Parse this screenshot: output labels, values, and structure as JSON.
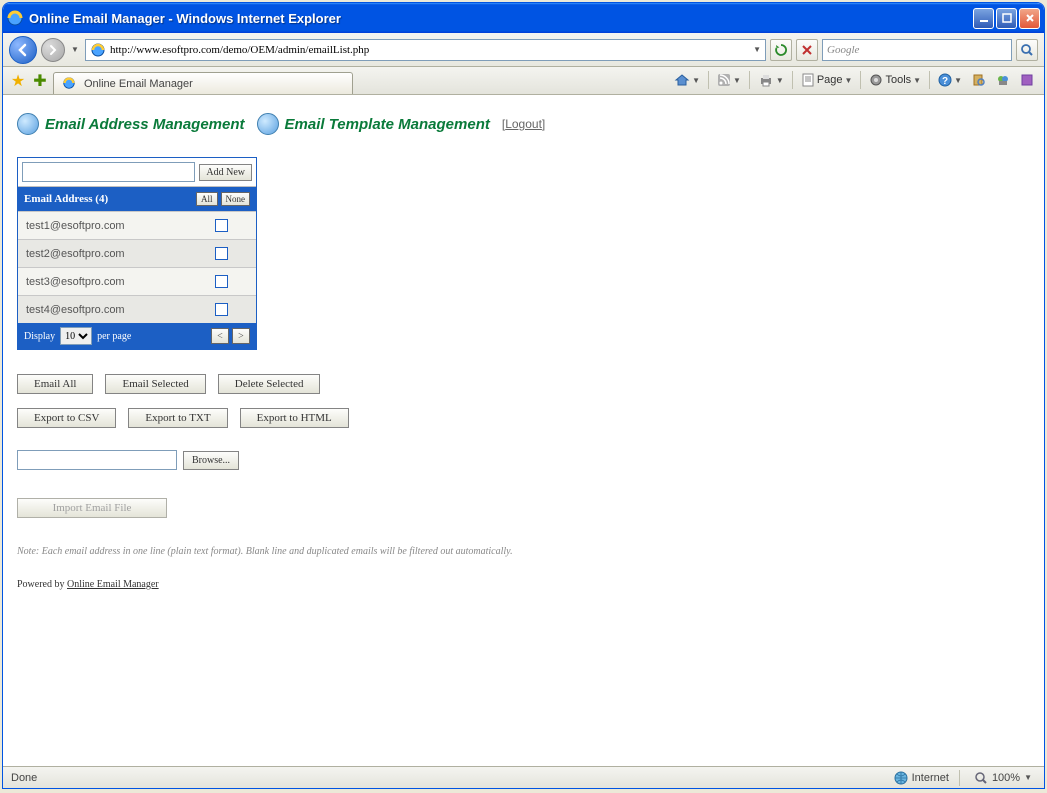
{
  "window": {
    "title": "Online Email Manager - Windows Internet Explorer"
  },
  "address": {
    "url": "http://www.esoftpro.com/demo/OEM/admin/emailList.php"
  },
  "search": {
    "placeholder": "Google"
  },
  "tab": {
    "title": "Online Email Manager"
  },
  "command_bar": {
    "page": "Page",
    "tools": "Tools"
  },
  "nav": {
    "email_mgmt": "Email Address Management",
    "template_mgmt": "Email Template Management",
    "logout": "Logout"
  },
  "panel": {
    "add_new": "Add New",
    "header": "Email Address (4)",
    "all": "All",
    "none": "None",
    "rows": [
      "test1@esoftpro.com",
      "test2@esoftpro.com",
      "test3@esoftpro.com",
      "test4@esoftpro.com"
    ],
    "display": "Display",
    "per_page": "per page",
    "page_size": "10"
  },
  "actions": {
    "email_all": "Email All",
    "email_selected": "Email Selected",
    "delete_selected": "Delete Selected",
    "export_csv": "Export to CSV",
    "export_txt": "Export to TXT",
    "export_html": "Export to HTML",
    "browse": "Browse...",
    "import": "Import Email File"
  },
  "note": "Note: Each email address in one line (plain text format). Blank line and duplicated emails will be filtered out automatically.",
  "powered": {
    "prefix": "Powered by ",
    "link": "Online Email Manager"
  },
  "status": {
    "left": "Done",
    "zone": "Internet",
    "zoom": "100%"
  }
}
